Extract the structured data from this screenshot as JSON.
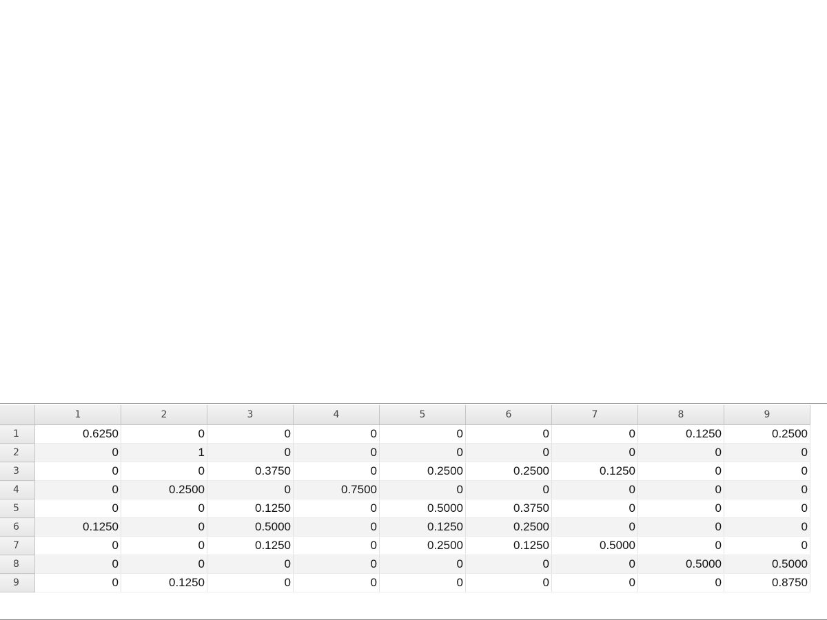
{
  "variable_editor": {
    "column_headers": [
      "1",
      "2",
      "3",
      "4",
      "5",
      "6",
      "7",
      "8",
      "9"
    ],
    "rows": [
      {
        "label": "1",
        "cells": [
          "0.6250",
          "0",
          "0",
          "0",
          "0",
          "0",
          "0",
          "0.1250",
          "0.2500"
        ]
      },
      {
        "label": "2",
        "cells": [
          "0",
          "1",
          "0",
          "0",
          "0",
          "0",
          "0",
          "0",
          "0"
        ]
      },
      {
        "label": "3",
        "cells": [
          "0",
          "0",
          "0.3750",
          "0",
          "0.2500",
          "0.2500",
          "0.1250",
          "0",
          "0"
        ]
      },
      {
        "label": "4",
        "cells": [
          "0",
          "0.2500",
          "0",
          "0.7500",
          "0",
          "0",
          "0",
          "0",
          "0"
        ]
      },
      {
        "label": "5",
        "cells": [
          "0",
          "0",
          "0.1250",
          "0",
          "0.5000",
          "0.3750",
          "0",
          "0",
          "0"
        ]
      },
      {
        "label": "6",
        "cells": [
          "0.1250",
          "0",
          "0.5000",
          "0",
          "0.1250",
          "0.2500",
          "0",
          "0",
          "0"
        ]
      },
      {
        "label": "7",
        "cells": [
          "0",
          "0",
          "0.1250",
          "0",
          "0.2500",
          "0.1250",
          "0.5000",
          "0",
          "0"
        ]
      },
      {
        "label": "8",
        "cells": [
          "0",
          "0",
          "0",
          "0",
          "0",
          "0",
          "0",
          "0.5000",
          "0.5000"
        ]
      },
      {
        "label": "9",
        "cells": [
          "0",
          "0.1250",
          "0",
          "0",
          "0",
          "0",
          "0",
          "0",
          "0.8750"
        ]
      }
    ]
  }
}
